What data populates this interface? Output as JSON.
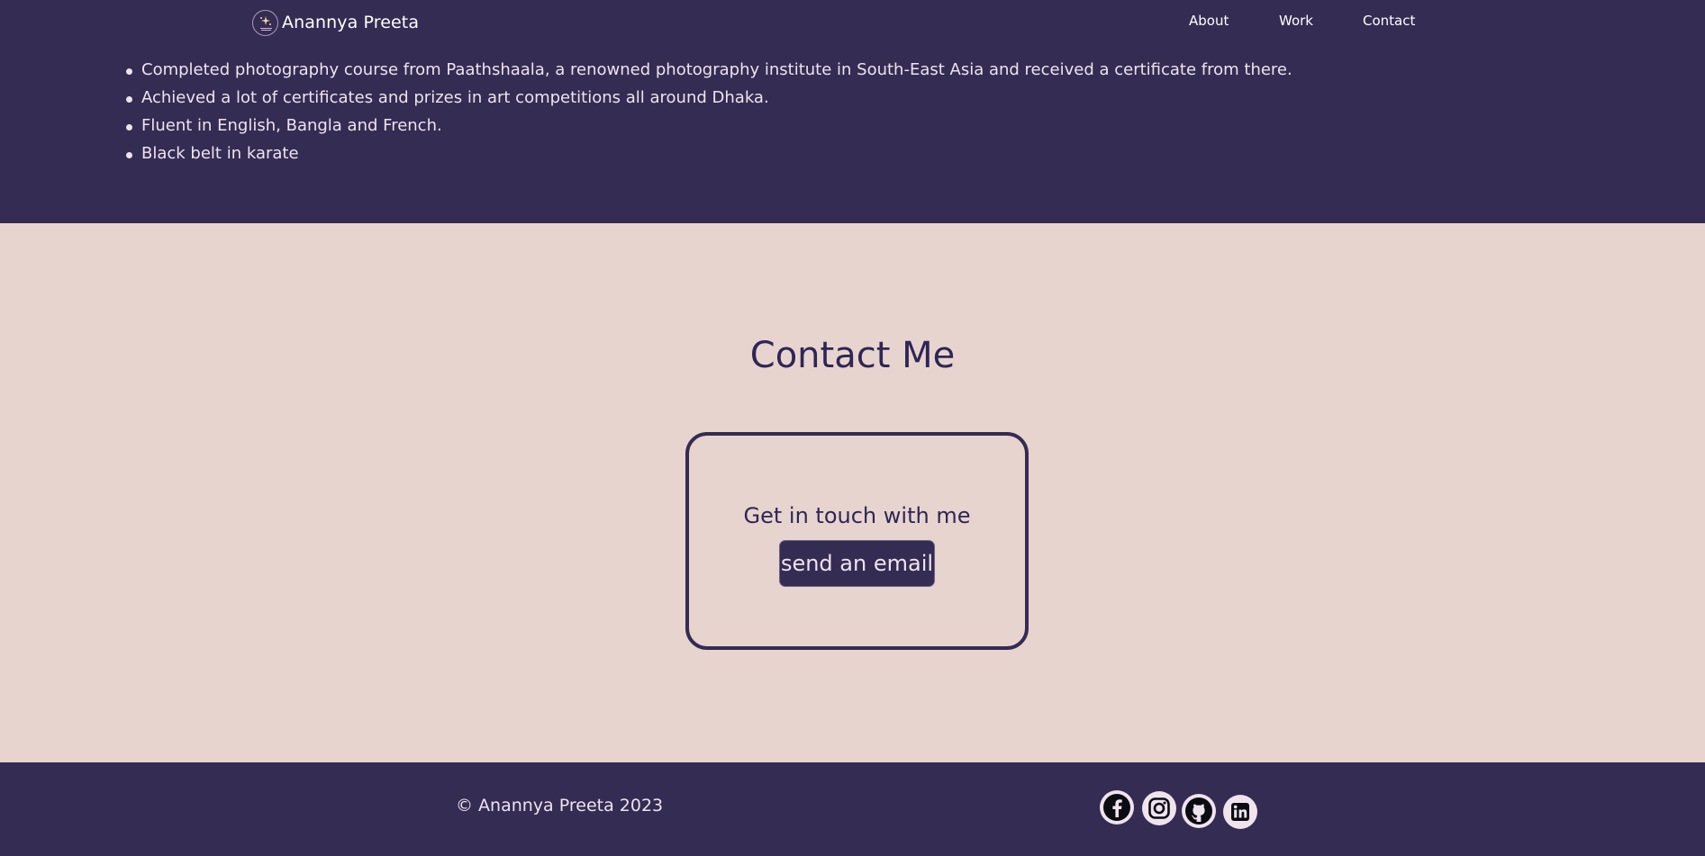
{
  "nav": {
    "brand_name": "Anannya Preeta",
    "links": [
      {
        "label": "About"
      },
      {
        "label": "Work"
      },
      {
        "label": "Contact"
      }
    ]
  },
  "achievements": {
    "items": [
      "Completed photography course from Paathshaala, a renowned photography institute in South-East Asia and received a certificate from there.",
      "Achieved a lot of certificates and prizes in art competitions all around Dhaka.",
      "Fluent in English, Bangla and French.",
      "Black belt in karate"
    ]
  },
  "contact": {
    "title": "Contact Me",
    "card_text": "Get in touch with me",
    "button_label": "send an email"
  },
  "footer": {
    "copyright": "© Anannya Preeta 2023",
    "social_icons": [
      "facebook-icon",
      "instagram-icon",
      "github-icon",
      "linkedin-icon"
    ]
  },
  "colors": {
    "dark_purple": "#342c52",
    "blush": "#e8d4cf",
    "heading": "#2e2654",
    "light_text": "#efe3ee"
  }
}
